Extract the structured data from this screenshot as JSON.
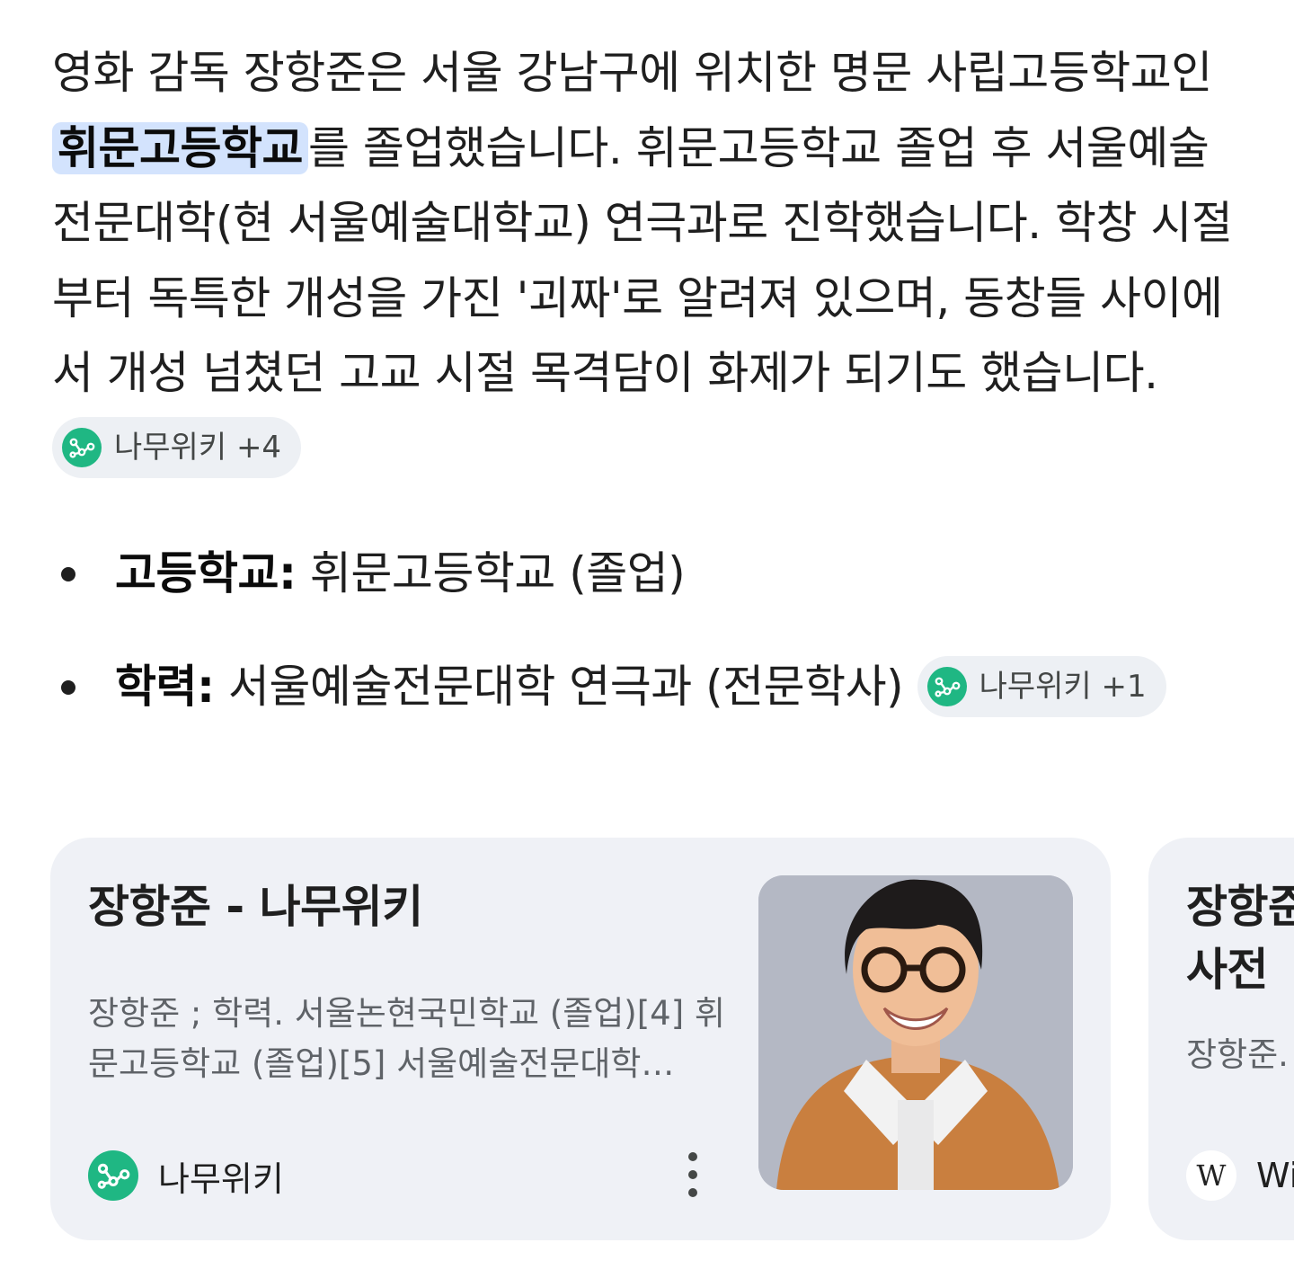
{
  "answer": {
    "text_before": "영화 감독 장항준은 서울 강남구에 위치한 명문 사립고등학교인 ",
    "highlight": "휘문고등학교",
    "text_after": "를 졸업했습니다. 휘문고등학교 졸업 후 서울예술전문대학(현 서울예술대학교) 연극과로 진학했습니다. 학창 시절부터 독특한 개성을 가진 '괴짜'로 알려져 있으며, 동창들 사이에서 개성 넘쳤던 고교 시절 목격담이 화제가 되기도 했습니다. ",
    "chip": {
      "label": "나무위키",
      "count": "+4"
    }
  },
  "bullets": [
    {
      "term": "고등학교:",
      "value": " 휘문고등학교 (졸업)"
    },
    {
      "term": "학력:",
      "value": " 서울예술전문대학 연극과 (전문학사) ",
      "chip": {
        "label": "나무위키",
        "count": "+1"
      }
    }
  ],
  "cards": [
    {
      "title": "장항준 - 나무위키",
      "snippet": "장항준 ; 학력. 서울논현국민학교 (졸업)[4] 휘문고등학교 (졸업)[5] 서울예술전문대학…",
      "source": "나무위키",
      "brand_color": "#1fb783"
    },
    {
      "title": "장항준 - 위키백과사전",
      "snippet": "장항준. 는 중…",
      "source": "Wikipedia",
      "logo_letter": "W"
    }
  ]
}
